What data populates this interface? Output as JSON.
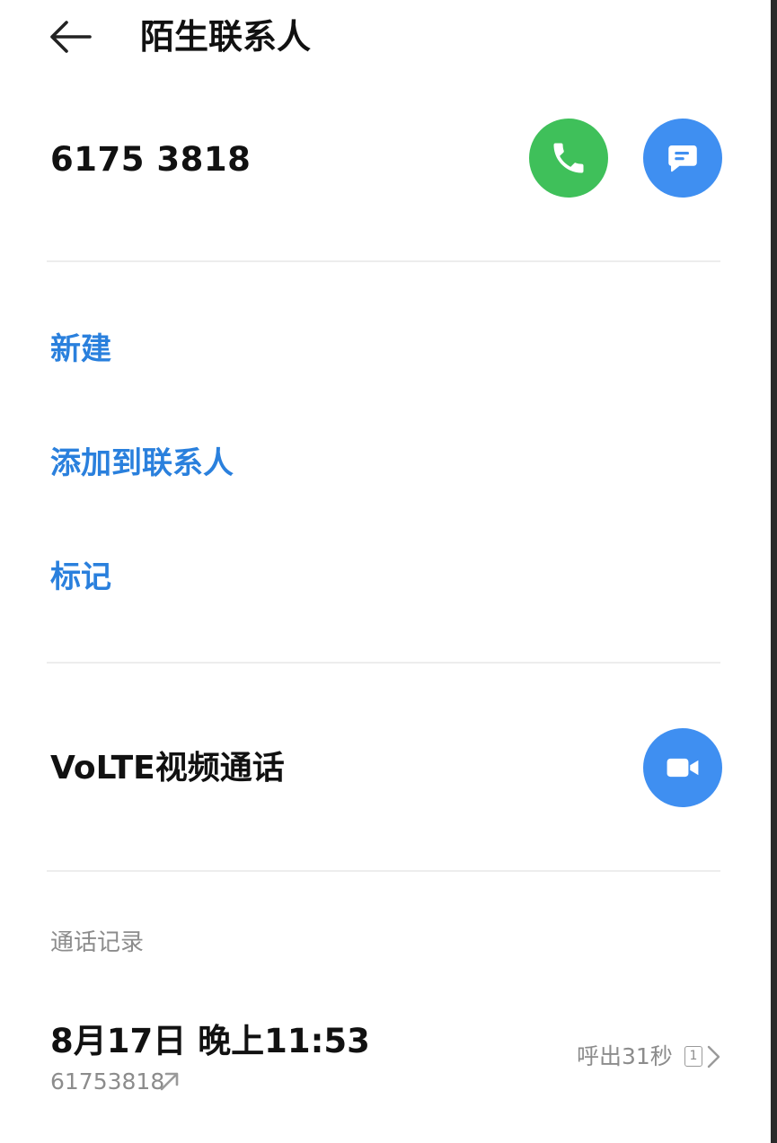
{
  "header": {
    "title": "陌生联系人",
    "back_icon": "arrow-left-icon"
  },
  "contact": {
    "number": "6175 3818",
    "call_icon": "phone-icon",
    "message_icon": "message-icon"
  },
  "actions": {
    "new_label": "新建",
    "add_label": "添加到联系人",
    "mark_label": "标记"
  },
  "volte": {
    "label": "VoLTE视频通话",
    "video_icon": "video-camera-icon"
  },
  "call_log": {
    "section_label": "通话记录",
    "entries": [
      {
        "date": "8月17日 晚上11:53",
        "number": "61753818",
        "direction_icon": "outgoing-arrow-icon",
        "duration": "呼出31秒",
        "sim": "1"
      }
    ]
  },
  "colors": {
    "accent": "#2a80dd",
    "call_green": "#3fc05a",
    "action_blue": "#3f8ff1"
  }
}
